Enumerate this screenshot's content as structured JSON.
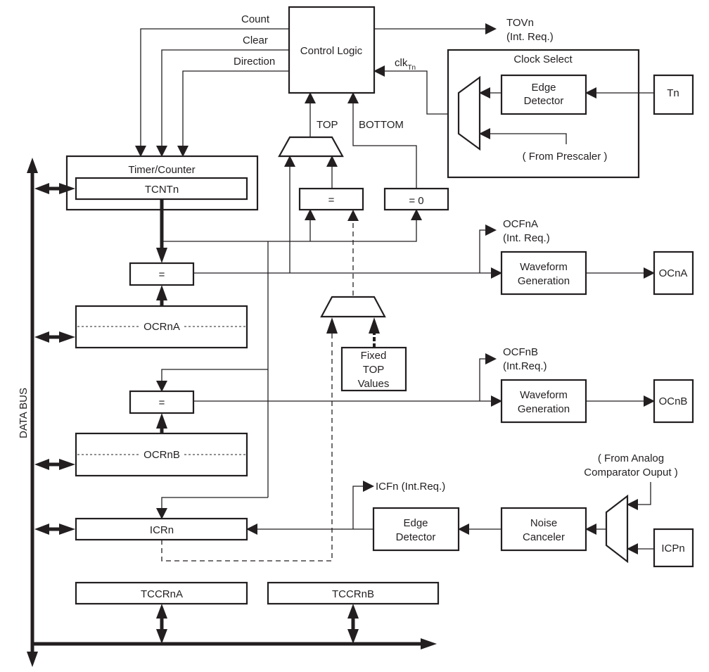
{
  "control_logic": {
    "label": "Control Logic",
    "count": "Count",
    "clear": "Clear",
    "direction": "Direction",
    "tov": "TOVn",
    "tov_req": "(Int. Req.)",
    "clk": "clk",
    "clk_sub": "Tn",
    "top": "TOP",
    "bottom": "BOTTOM"
  },
  "clock_select": {
    "title": "Clock Select",
    "edge_detector_1": "Edge",
    "edge_detector_2": "Detector",
    "tn": "Tn",
    "prescaler": "( From Prescaler )"
  },
  "timer_counter": {
    "title": "Timer/Counter",
    "register": "TCNTn"
  },
  "comparators": {
    "eq": "=",
    "eq0": "= 0"
  },
  "ocr_a": {
    "label": "OCRnA",
    "flag": "OCFnA",
    "flag_req": "(Int. Req.)",
    "wave_1": "Waveform",
    "wave_2": "Generation",
    "output": "OCnA"
  },
  "ocr_b": {
    "label": "OCRnB",
    "flag": "OCFnB",
    "flag_req": "(Int.Req.)",
    "wave_1": "Waveform",
    "wave_2": "Generation",
    "output": "OCnB"
  },
  "fixed_top": {
    "line1": "Fixed",
    "line2": "TOP",
    "line3": "Values"
  },
  "input_capture": {
    "register": "ICRn",
    "flag": "ICFn (Int.Req.)",
    "edge_1": "Edge",
    "edge_2": "Detector",
    "noise_1": "Noise",
    "noise_2": "Canceler",
    "analog_1": "( From Analog",
    "analog_2": "Comparator Ouput )",
    "pin": "ICPn"
  },
  "control_regs": {
    "a": "TCCRnA",
    "b": "TCCRnB"
  },
  "bus": {
    "label": "DATA BUS"
  }
}
